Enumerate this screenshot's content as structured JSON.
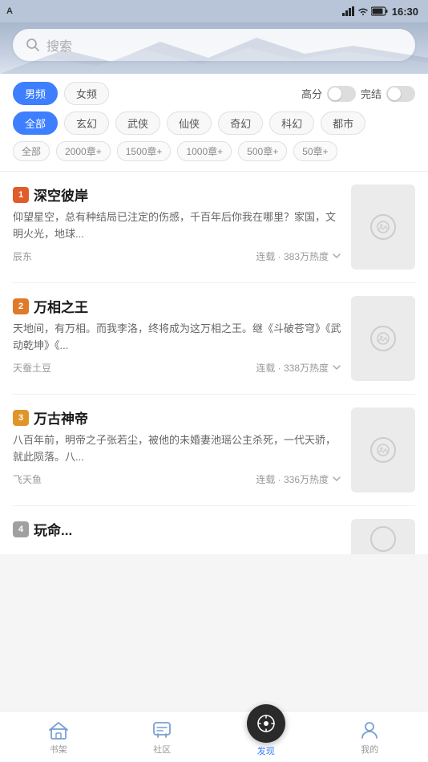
{
  "statusBar": {
    "carrier": "A",
    "time": "16:30",
    "batteryIcon": "🔋"
  },
  "header": {
    "searchPlaceholder": "搜索"
  },
  "filters": {
    "genderTabs": [
      {
        "label": "男频",
        "active": true
      },
      {
        "label": "女频",
        "active": false
      }
    ],
    "toggles": [
      {
        "label": "高分"
      },
      {
        "label": "完结"
      }
    ],
    "genreTags": [
      {
        "label": "全部",
        "active": true
      },
      {
        "label": "玄幻",
        "active": false
      },
      {
        "label": "武侠",
        "active": false
      },
      {
        "label": "仙侠",
        "active": false
      },
      {
        "label": "奇幻",
        "active": false
      },
      {
        "label": "科幻",
        "active": false
      },
      {
        "label": "都市",
        "active": false
      }
    ],
    "chapterTags": [
      {
        "label": "全部"
      },
      {
        "label": "2000章+"
      },
      {
        "label": "1500章+"
      },
      {
        "label": "1000章+"
      },
      {
        "label": "500章+"
      },
      {
        "label": "50章+"
      }
    ]
  },
  "books": [
    {
      "rank": 1,
      "title": "深空彼岸",
      "desc": "仰望星空，总有种结局已注定的伤感，千百年后你我在哪里？家国，文明火光，地球...",
      "author": "辰东",
      "stats": "连载 · 383万热度",
      "rankClass": "rank-1"
    },
    {
      "rank": 2,
      "title": "万相之王",
      "desc": "天地间，有万相。而我李洛，终将成为这万相之王。继《斗破苍穹》《武动乾坤》《...",
      "author": "天蚕土豆",
      "stats": "连载 · 338万热度",
      "rankClass": "rank-2"
    },
    {
      "rank": 3,
      "title": "万古神帝",
      "desc": "八百年前，明帝之子张若尘，被他的未婚妻池瑶公主杀死，一代天骄，就此陨落。八...",
      "author": "飞天鱼",
      "stats": "连载 · 336万热度",
      "rankClass": "rank-3"
    },
    {
      "rank": 4,
      "title": "玩命...",
      "desc": "",
      "author": "",
      "stats": "",
      "rankClass": "rank-4"
    }
  ],
  "bottomNav": [
    {
      "label": "书架",
      "active": false,
      "icon": "home"
    },
    {
      "label": "社区",
      "active": false,
      "icon": "chat"
    },
    {
      "label": "发现",
      "active": true,
      "icon": "discover"
    },
    {
      "label": "我的",
      "active": false,
      "icon": "user"
    }
  ]
}
